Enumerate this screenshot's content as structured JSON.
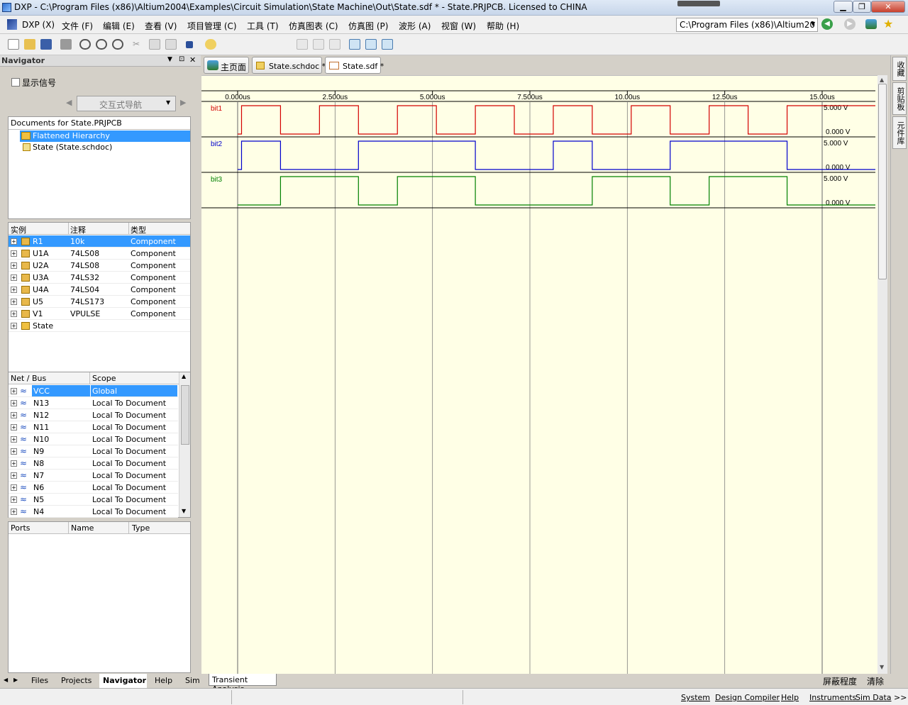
{
  "window": {
    "title": "DXP - C:\\Program Files (x86)\\Altium2004\\Examples\\Circuit Simulation\\State Machine\\Out\\State.sdf * - State.PRJPCB. Licensed to CHINA",
    "controls": [
      "minimize",
      "restore",
      "close"
    ]
  },
  "menu": {
    "items": [
      "DXP (X)",
      "文件 (F)",
      "编辑 (E)",
      "查看 (V)",
      "项目管理 (C)",
      "工具 (T)",
      "仿真图表 (C)",
      "仿真图 (P)",
      "波形 (A)",
      "视窗 (W)",
      "帮助 (H)"
    ],
    "path": "C:\\Program Files (x86)\\Altium20"
  },
  "navigator": {
    "title": "Navigator",
    "show_signals": "显示信号",
    "interactive_nav": "交互式导航",
    "documents_header": "Documents for State.PRJPCB",
    "documents": [
      "Flattened Hierarchy",
      "State (State.schdoc)"
    ],
    "instances": {
      "columns": [
        "实例",
        "注释",
        "类型"
      ],
      "rows": [
        {
          "inst": "R1",
          "note": "10k",
          "type": "Component"
        },
        {
          "inst": "U1A",
          "note": "74LS08",
          "type": "Component"
        },
        {
          "inst": "U2A",
          "note": "74LS08",
          "type": "Component"
        },
        {
          "inst": "U3A",
          "note": "74LS32",
          "type": "Component"
        },
        {
          "inst": "U4A",
          "note": "74LS04",
          "type": "Component"
        },
        {
          "inst": "U5",
          "note": "74LS173",
          "type": "Component"
        },
        {
          "inst": "V1",
          "note": "VPULSE",
          "type": "Component"
        },
        {
          "inst": "State",
          "note": "",
          "type": ""
        }
      ]
    },
    "nets": {
      "columns": [
        "Net / Bus",
        "Scope"
      ],
      "rows": [
        {
          "net": "VCC",
          "scope": "Global"
        },
        {
          "net": "N13",
          "scope": "Local To Document"
        },
        {
          "net": "N12",
          "scope": "Local To Document"
        },
        {
          "net": "N11",
          "scope": "Local To Document"
        },
        {
          "net": "N10",
          "scope": "Local To Document"
        },
        {
          "net": "N9",
          "scope": "Local To Document"
        },
        {
          "net": "N8",
          "scope": "Local To Document"
        },
        {
          "net": "N7",
          "scope": "Local To Document"
        },
        {
          "net": "N6",
          "scope": "Local To Document"
        },
        {
          "net": "N5",
          "scope": "Local To Document"
        },
        {
          "net": "N4",
          "scope": "Local To Document"
        }
      ]
    },
    "ports": {
      "columns": [
        "Ports",
        "Name",
        "Type"
      ]
    }
  },
  "doc_tabs": [
    "主页面",
    "State.schdoc *",
    "State.sdf *"
  ],
  "waveform": {
    "time_ticks": [
      "0.000us",
      "2.500us",
      "5.000us",
      "7.500us",
      "10.00us",
      "12.50us",
      "15.00us"
    ],
    "signals": [
      {
        "name": "bit1",
        "color": "#d40000",
        "vmax": "5.000 V",
        "vmin": "0.000 V"
      },
      {
        "name": "bit2",
        "color": "#0000cc",
        "vmax": "5.000 V",
        "vmin": "0.000 V"
      },
      {
        "name": "bit3",
        "color": "#008000",
        "vmax": "5.000 V",
        "vmin": "0.000 V"
      }
    ]
  },
  "bottom_tabs": [
    "Files",
    "Projects",
    "Navigator",
    "Help",
    "Sim"
  ],
  "analysis_tab": "Transient Analysis",
  "analysis_actions": [
    "屏蔽程度",
    "清除"
  ],
  "status_items": [
    "System",
    "Design Compiler",
    "Help",
    "Instruments",
    "Sim Data",
    ">>"
  ],
  "dock_tabs": [
    "收藏",
    "剪贴板",
    "元件库"
  ]
}
